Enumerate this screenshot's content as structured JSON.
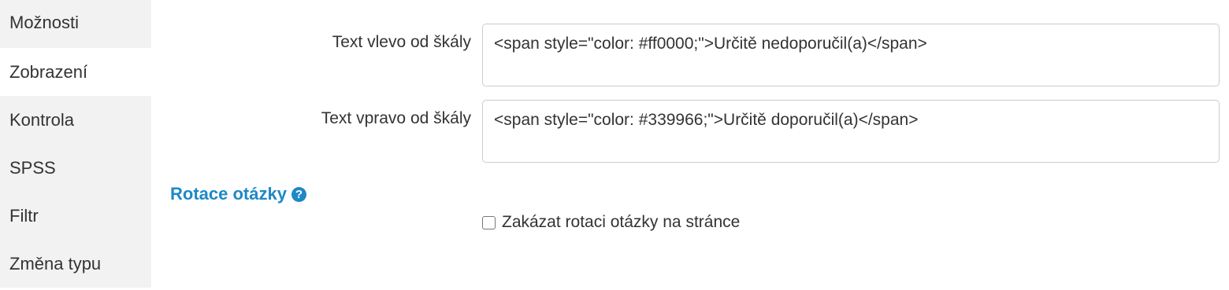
{
  "sidebar": {
    "items": [
      {
        "label": "Možnosti"
      },
      {
        "label": "Zobrazení"
      },
      {
        "label": "Kontrola"
      },
      {
        "label": "SPSS"
      },
      {
        "label": "Filtr"
      },
      {
        "label": "Změna typu"
      }
    ],
    "active": "Zobrazení"
  },
  "fields": {
    "left_text": {
      "label": "Text vlevo od škály",
      "value": "<span style=\"color: #ff0000;\">Určitě nedoporučil(a)</span>"
    },
    "right_text": {
      "label": "Text vpravo od škály",
      "value": "<span style=\"color: #339966;\">Určitě doporučil(a)</span>"
    }
  },
  "rotation": {
    "title": "Rotace otázky",
    "help_glyph": "?",
    "checkbox_label": "Zakázat rotaci otázky na stránce",
    "checked": false
  },
  "colors": {
    "accent": "#1e88c7",
    "sidebar_bg": "#f2f2f2"
  }
}
